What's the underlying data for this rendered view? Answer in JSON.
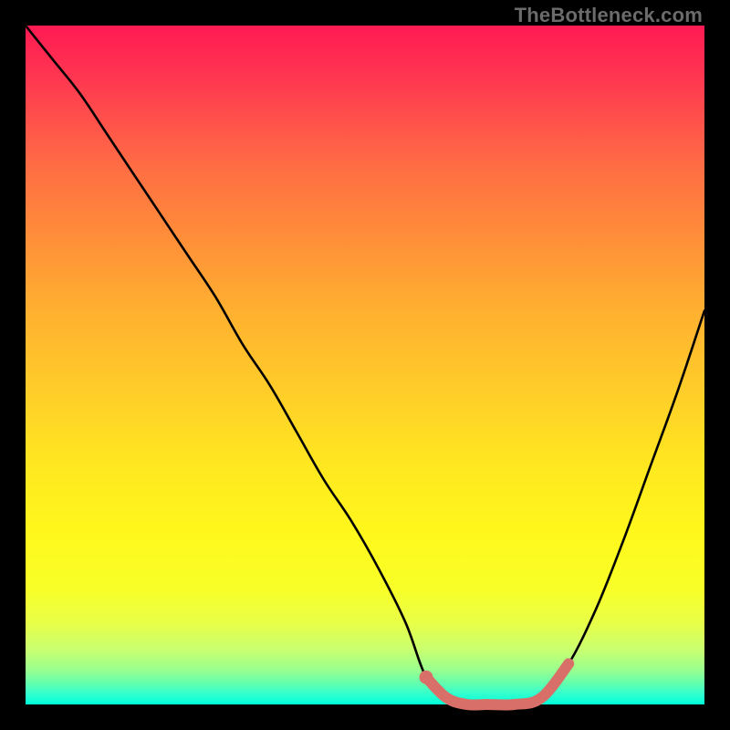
{
  "watermark": "TheBottleneck.com",
  "chart_data": {
    "type": "line",
    "title": "",
    "xlabel": "",
    "ylabel": "",
    "xlim": [
      0,
      100
    ],
    "ylim": [
      0,
      100
    ],
    "x": [
      0,
      4,
      8,
      12,
      16,
      20,
      24,
      28,
      32,
      36,
      40,
      44,
      48,
      52,
      56,
      59,
      62,
      65,
      68,
      72,
      76,
      80,
      84,
      88,
      92,
      96,
      100
    ],
    "values": [
      100,
      95,
      90,
      84,
      78,
      72,
      66,
      60,
      53,
      47,
      40,
      33,
      27,
      20,
      12,
      4,
      1,
      0,
      0,
      0,
      1,
      6,
      14,
      24,
      35,
      46,
      58
    ],
    "highlight_segment": {
      "x": [
        59,
        62,
        65,
        68,
        72,
        76,
        80
      ],
      "values": [
        4,
        1,
        0,
        0,
        0,
        1,
        6
      ]
    },
    "colors": {
      "line": "#000000",
      "highlight": "#d86f68",
      "gradient_top": "#ff1a53",
      "gradient_bottom": "#00ffd8"
    }
  }
}
